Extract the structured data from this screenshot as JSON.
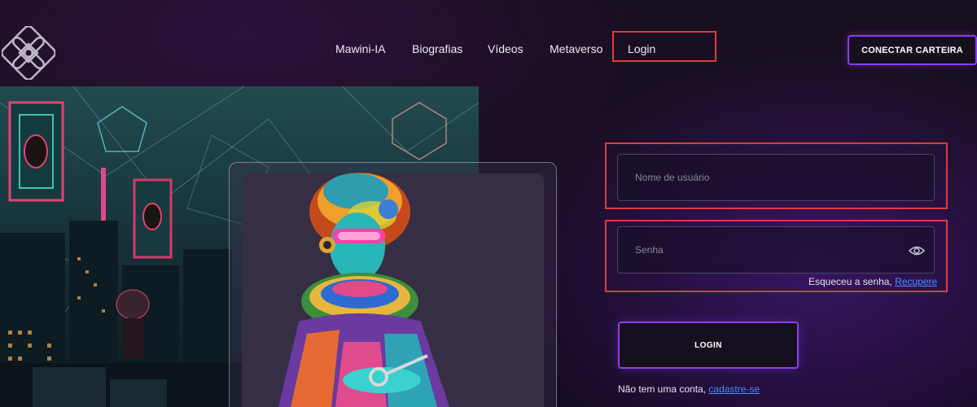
{
  "header": {
    "logo_icon": "mawini-logo-icon",
    "nav": [
      {
        "label": "Mawini-IA"
      },
      {
        "label": "Biografias"
      },
      {
        "label": "Vídeos"
      },
      {
        "label": "Metaverso"
      },
      {
        "label": "Login"
      }
    ],
    "connect_wallet_label": "CONECTAR CARTEIRA"
  },
  "art": {
    "scene_icon": "cyberpunk-city-artwork",
    "figure_icon": "african-queen-with-key-artwork"
  },
  "form": {
    "username_placeholder": "Nome de usuário",
    "password_placeholder": "Senha",
    "show_password_icon": "eye-icon",
    "forgot_text": "Esqueceu a senha,",
    "forgot_link": "Recupere",
    "login_label": "LOGIN",
    "signup_text": "Não tem uma conta,",
    "signup_link": "cadastre-se"
  },
  "colors": {
    "accent_purple": "#8d3df0",
    "highlight_red": "#e23b3b",
    "link_blue": "#4c8dff"
  }
}
